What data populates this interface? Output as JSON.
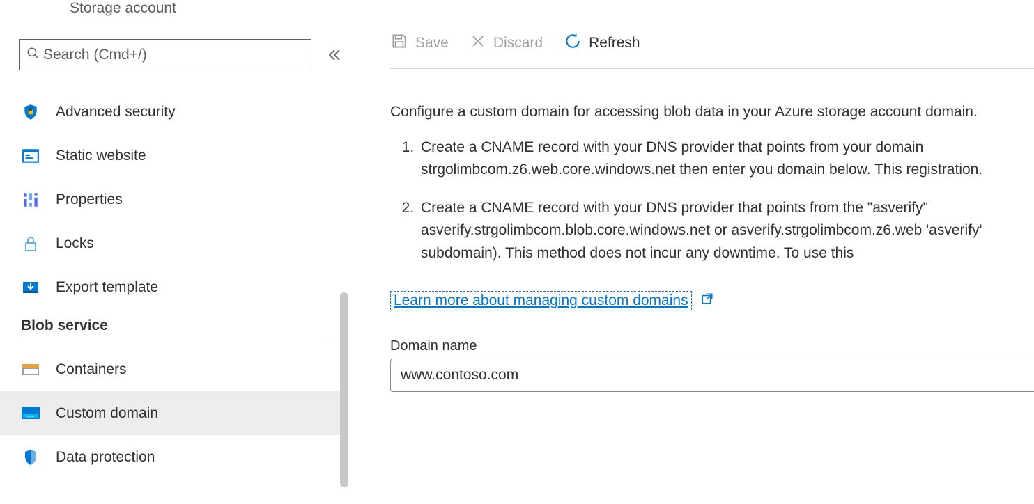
{
  "header": {
    "resourceType": "Storage account"
  },
  "search": {
    "placeholder": "Search (Cmd+/)"
  },
  "sidebar": {
    "items": [
      {
        "label": "Advanced security",
        "icon": "shield-lock-icon"
      },
      {
        "label": "Static website",
        "icon": "static-website-icon"
      },
      {
        "label": "Properties",
        "icon": "properties-icon"
      },
      {
        "label": "Locks",
        "icon": "lock-icon"
      },
      {
        "label": "Export template",
        "icon": "export-template-icon"
      }
    ],
    "sectionHeader": "Blob service",
    "blobItems": [
      {
        "label": "Containers",
        "icon": "containers-icon"
      },
      {
        "label": "Custom domain",
        "icon": "custom-domain-icon",
        "selected": true
      },
      {
        "label": "Data protection",
        "icon": "data-protection-icon"
      }
    ]
  },
  "toolbar": {
    "save": "Save",
    "discard": "Discard",
    "refresh": "Refresh"
  },
  "content": {
    "intro": "Configure a custom domain for accessing blob data in your Azure storage account domain.",
    "step1": "Create a CNAME record with your DNS provider that points from your domain strgolimbcom.z6.web.core.windows.net then enter you domain below. This registration.",
    "step2": "Create a CNAME record with your DNS provider that points from the \"asverify\" asverify.strgolimbcom.blob.core.windows.net or asverify.strgolimbcom.z6.web 'asverify' subdomain). This method does not incur any downtime. To use this",
    "learnMore": "Learn more about managing custom domains",
    "fieldLabel": "Domain name",
    "fieldValue": "www.contoso.com"
  }
}
